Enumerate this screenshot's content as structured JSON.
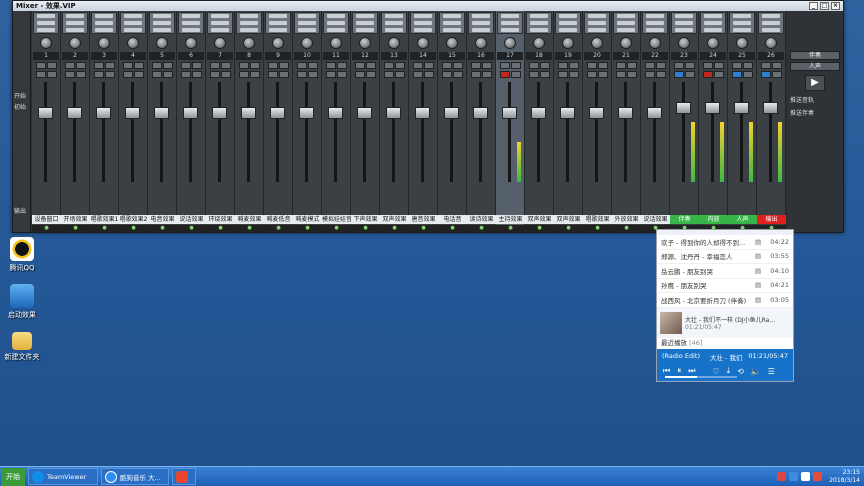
{
  "mixer": {
    "title": "Mixer - 效果.VIP",
    "channels": [
      {
        "num": "1",
        "label": "设备窗口"
      },
      {
        "num": "2",
        "label": "开场效果"
      },
      {
        "num": "3",
        "label": "唱歌效果1"
      },
      {
        "num": "4",
        "label": "唱歌效果2"
      },
      {
        "num": "5",
        "label": "电音效果"
      },
      {
        "num": "6",
        "label": "说话效果"
      },
      {
        "num": "7",
        "label": "环绕效果"
      },
      {
        "num": "8",
        "label": "喊麦效果"
      },
      {
        "num": "9",
        "label": "喊麦低音"
      },
      {
        "num": "10",
        "label": "喊麦模式"
      },
      {
        "num": "11",
        "label": "模拟娃娃音"
      },
      {
        "num": "12",
        "label": "下声效果"
      },
      {
        "num": "13",
        "label": "双声效果"
      },
      {
        "num": "14",
        "label": "唐音效果"
      },
      {
        "num": "15",
        "label": "电话音"
      },
      {
        "num": "16",
        "label": "读诗效果"
      },
      {
        "num": "17",
        "label": "主持效果"
      },
      {
        "num": "18",
        "label": "双声效果"
      },
      {
        "num": "19",
        "label": "双声效果"
      },
      {
        "num": "20",
        "label": "唱歌效果"
      },
      {
        "num": "21",
        "label": "外放效果"
      },
      {
        "num": "22",
        "label": "说话效果"
      },
      {
        "num": "23",
        "label": "伴奏"
      },
      {
        "num": "24",
        "label": "内放"
      },
      {
        "num": "25",
        "label": "人声"
      },
      {
        "num": "26",
        "label": "输出"
      }
    ],
    "side_labels": [
      "开始",
      "初始",
      "输出"
    ],
    "right_panel": {
      "btn1": "伴奏",
      "btn2": "人声",
      "opt1": "推送音轨",
      "opt2": "推送伴奏"
    }
  },
  "player": {
    "rows": [
      {
        "title": "欢子 - 得到你的人却得不到...",
        "dur": "04:22"
      },
      {
        "title": "郑源、沈丹丹 - 幸福恋人",
        "dur": "03:55"
      },
      {
        "title": "岳云鹏 - 朋友别哭",
        "dur": "04:10"
      },
      {
        "title": "孙鹰 - 朋友别哭",
        "dur": "04:21"
      },
      {
        "title": "战西风 - 北京要折月刀 (伴奏)",
        "dur": "03:05"
      }
    ],
    "now_title": "大壮 - 我们不一样 (DJ小鱼儿Ra...",
    "now_time": "01:21/05:47",
    "recent_label": "最近播放",
    "recent_count": "[46]",
    "bar_title": "(Radio Edit)",
    "bar_artist": "大壮 - 我们",
    "bar_time": "01:21/05:47"
  },
  "desktop": {
    "icons": [
      {
        "label": "腾讯QQ"
      },
      {
        "label": "启动效果"
      },
      {
        "label": "新建文件夹"
      }
    ]
  },
  "taskbar": {
    "start": "开始",
    "tasks": [
      {
        "label": "TeamViewer"
      },
      {
        "label": "酷狗音乐 大..."
      }
    ],
    "time": "23:15",
    "date": "2018/3/14"
  }
}
